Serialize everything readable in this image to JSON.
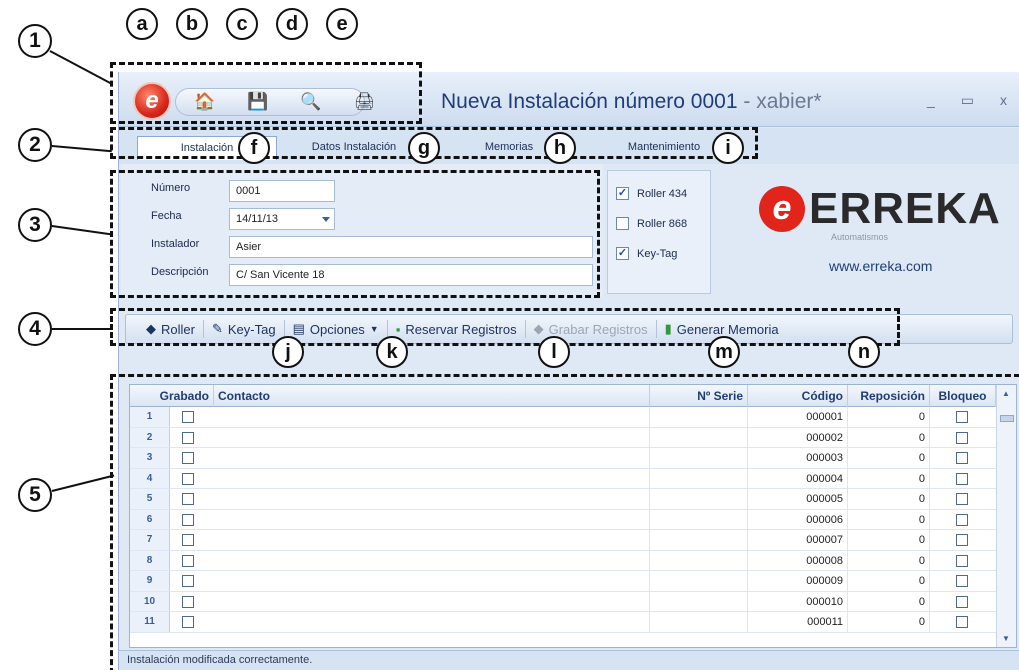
{
  "window": {
    "title": "Nueva Instalación número 0001",
    "user": " - xabier*",
    "controls": {
      "minimize": "_",
      "maximize": "▭",
      "close": "x"
    }
  },
  "quick_access": {
    "orb_letter": "e",
    "buttons": [
      {
        "name": "home",
        "icon": "🏠"
      },
      {
        "name": "save",
        "icon": "💾"
      },
      {
        "name": "search",
        "icon": "🔍"
      },
      {
        "name": "print",
        "icon": "🖨"
      }
    ]
  },
  "tabs": [
    "Instalación",
    "Datos Instalación",
    "Memorias",
    "Mantenimiento"
  ],
  "form": {
    "numero_label": "Número",
    "numero_value": "0001",
    "fecha_label": "Fecha",
    "fecha_value": "14/11/13",
    "instalador_label": "Instalador",
    "instalador_value": "Asier",
    "descripcion_label": "Descripción",
    "descripcion_value": "C/ San Vicente 18"
  },
  "checks": [
    {
      "label": "Roller 434",
      "checked": true
    },
    {
      "label": "Roller 868",
      "checked": false
    },
    {
      "label": "Key-Tag",
      "checked": true
    }
  ],
  "brand": {
    "name": "ERREKA",
    "sub": "Automatismos",
    "url": "www.erreka.com"
  },
  "toolbar": {
    "roller": "Roller",
    "keytag": "Key-Tag",
    "opciones": "Opciones",
    "reservar": "Reservar Registros",
    "grabar": "Grabar Registros",
    "generar": "Generar Memoria"
  },
  "grid": {
    "headers": {
      "grabado": "Grabado",
      "contacto": "Contacto",
      "serie": "Nº Serie",
      "codigo": "Código",
      "reposicion": "Reposición",
      "bloqueo": "Bloqueo"
    },
    "rows": [
      {
        "n": "1",
        "codigo": "000001",
        "reposicion": "0"
      },
      {
        "n": "2",
        "codigo": "000002",
        "reposicion": "0"
      },
      {
        "n": "3",
        "codigo": "000003",
        "reposicion": "0"
      },
      {
        "n": "4",
        "codigo": "000004",
        "reposicion": "0"
      },
      {
        "n": "5",
        "codigo": "000005",
        "reposicion": "0"
      },
      {
        "n": "6",
        "codigo": "000006",
        "reposicion": "0"
      },
      {
        "n": "7",
        "codigo": "000007",
        "reposicion": "0"
      },
      {
        "n": "8",
        "codigo": "000008",
        "reposicion": "0"
      },
      {
        "n": "9",
        "codigo": "000009",
        "reposicion": "0"
      },
      {
        "n": "10",
        "codigo": "000010",
        "reposicion": "0"
      },
      {
        "n": "11",
        "codigo": "000011",
        "reposicion": "0"
      }
    ]
  },
  "status": "Instalación modificada correctamente.",
  "callouts": {
    "numbers": [
      "1",
      "2",
      "3",
      "4",
      "5"
    ],
    "letters": [
      "a",
      "b",
      "c",
      "d",
      "e",
      "f",
      "g",
      "h",
      "i",
      "j",
      "k",
      "l",
      "m",
      "n"
    ]
  }
}
